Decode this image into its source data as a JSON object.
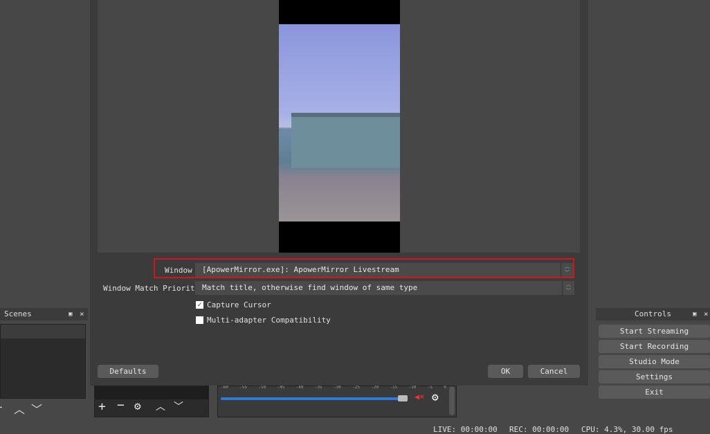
{
  "dialog": {
    "window_label": "Window",
    "window_value": "[ApowerMirror.exe]: ApowerMirror Livestream",
    "priority_label": "Window Match Priority",
    "priority_value": "Match title, otherwise find window of same type",
    "capture_cursor": {
      "label": "Capture Cursor",
      "checked": true
    },
    "multi_adapter": {
      "label": "Multi-adapter Compatibility",
      "checked": false
    },
    "defaults": "Defaults",
    "ok": "OK",
    "cancel": "Cancel",
    "highlight_color": "#d0161b"
  },
  "scenes": {
    "title": "Scenes"
  },
  "mixer": {
    "ticks": [
      "-60",
      "-55",
      "-50",
      "-45",
      "-40",
      "-35",
      "-30",
      "-25",
      "-20",
      "-15",
      "-10",
      "-5",
      "0"
    ],
    "volume_percent": 98,
    "muted": true
  },
  "controls": {
    "title": "Controls",
    "buttons": [
      "Start Streaming",
      "Start Recording",
      "Studio Mode",
      "Settings",
      "Exit"
    ]
  },
  "status": {
    "live": "LIVE: 00:00:00",
    "rec": "REC: 00:00:00",
    "cpu": "CPU: 4.3%, 30.00 fps"
  }
}
